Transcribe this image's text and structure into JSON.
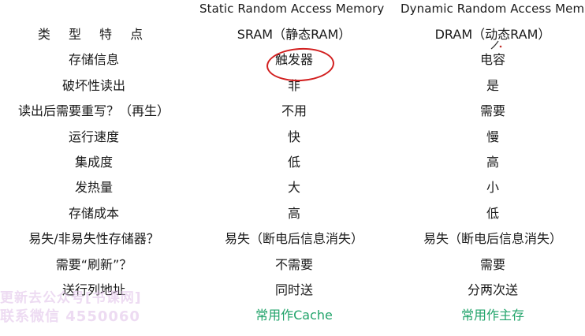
{
  "headers": {
    "sram_en": "Static Random Access Memory",
    "dram_en": "Dynamic Random Access Memo"
  },
  "table": {
    "columns": [
      "类 型 特 点",
      "SRAM（静态RAM）",
      "DRAM（动态RAM）"
    ],
    "rows": [
      [
        "存储信息",
        "触发器",
        "电容"
      ],
      [
        "破坏性读出",
        "非",
        "是"
      ],
      [
        "读出后需要重写？（再生）",
        "不用",
        "需要"
      ],
      [
        "运行速度",
        "快",
        "慢"
      ],
      [
        "集成度",
        "低",
        "高"
      ],
      [
        "发热量",
        "大",
        "小"
      ],
      [
        "存储成本",
        "高",
        "低"
      ],
      [
        "易失/非易失性存储器？",
        "易失（断电后信息消失）",
        "易失（断电后信息消失）"
      ],
      [
        "需要“刷新”？",
        "不需要",
        "需要"
      ],
      [
        "送行列地址",
        "同时送",
        "分两次送"
      ],
      [
        "",
        "常用作Cache",
        "常用作主存"
      ]
    ]
  },
  "annotation": {
    "circle_color": "#d21f1f",
    "highlight_color": "#22a46b"
  },
  "watermark": {
    "line1": "更新去公众号[书课网]",
    "line2": "联系微信 4550060"
  }
}
